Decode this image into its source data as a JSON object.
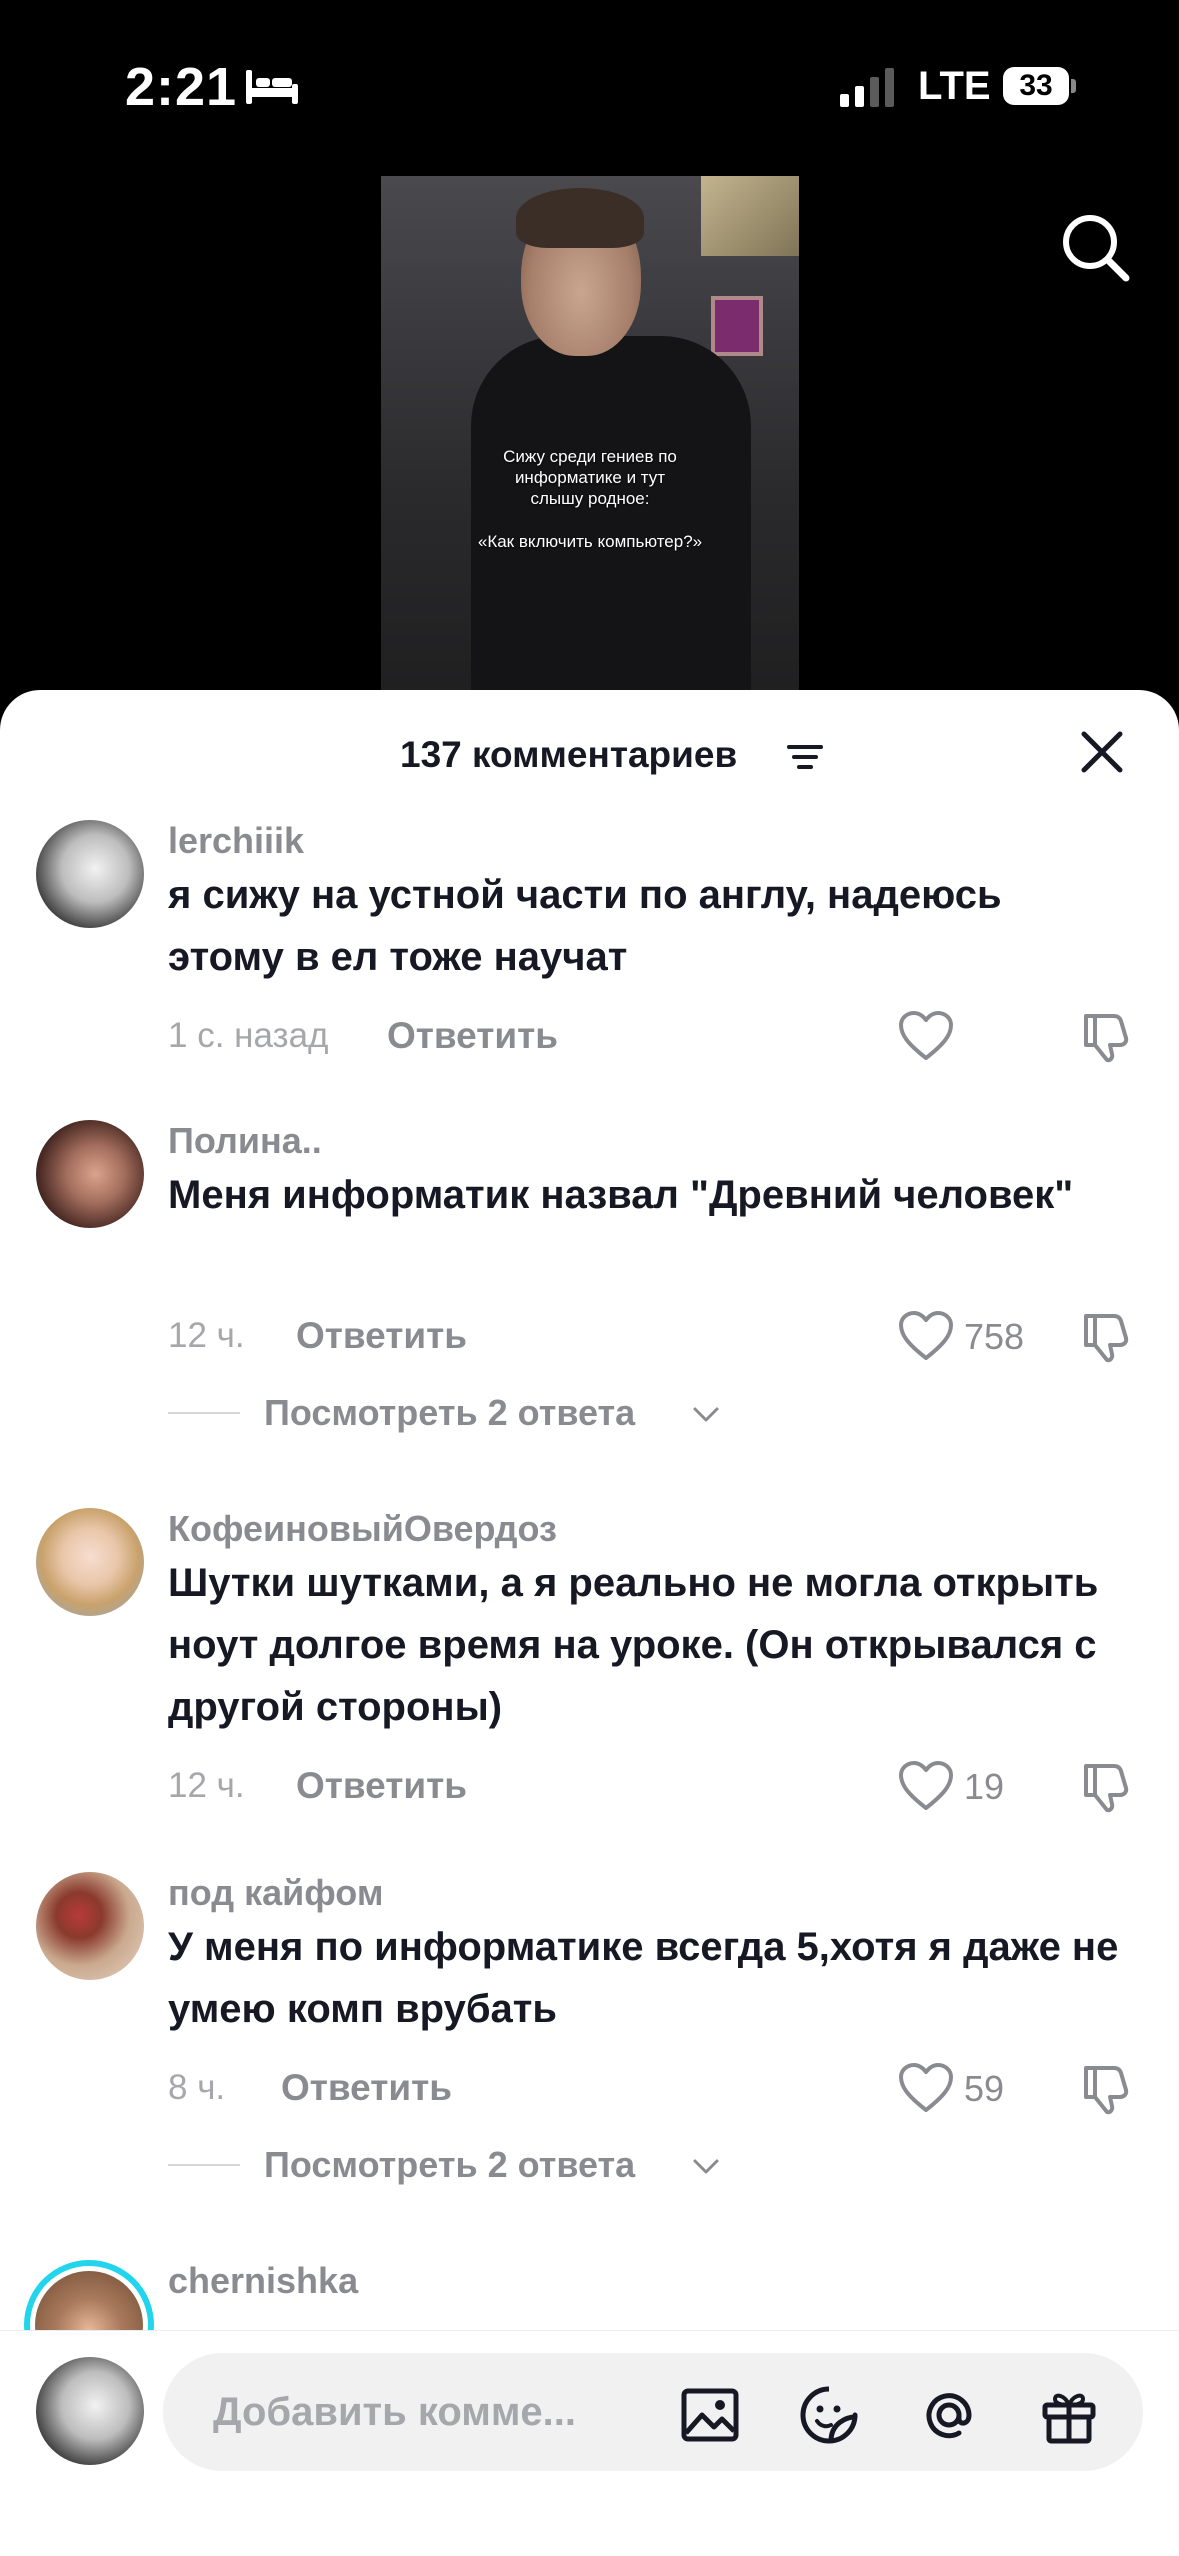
{
  "status_bar": {
    "time": "2:21",
    "network": "LTE",
    "battery": "33"
  },
  "video": {
    "caption_lines": [
      "Сижу среди гениев по",
      "информатике и тут",
      "слышу родное:"
    ],
    "caption_quote": "«Как включить компьютер?»"
  },
  "sheet": {
    "title": "137 комментариев"
  },
  "comments": [
    {
      "user": "lerchiiik",
      "text": "я сижу на устной части по англу, надеюсь этому в ел тоже научат",
      "time": "1 с. назад",
      "reply": "Ответить",
      "likes": ""
    },
    {
      "user": "Полина..",
      "text": "Меня информатик назвал \"Древний человек\"",
      "time": "12 ч.",
      "reply": "Ответить",
      "likes": "758",
      "view_replies": "Посмотреть 2 ответа"
    },
    {
      "user": "КофеиновыйОвердоз",
      "text": "Шутки шутками, а я реально не могла открыть ноут долгое время на уроке. (Он открывался с другой стороны)",
      "time": "12 ч.",
      "reply": "Ответить",
      "likes": "19"
    },
    {
      "user": "под кайфом",
      "text": "У меня по информатике всегда 5,хотя я даже не умею комп врубать",
      "time": "8 ч.",
      "reply": "Ответить",
      "likes": "59",
      "view_replies": "Посмотреть 2 ответа"
    },
    {
      "user": "chernishka"
    }
  ],
  "input": {
    "placeholder": "Добавить комме..."
  },
  "colors": {
    "text": "#161823",
    "muted": "#8a8b91",
    "background": "#ffffff",
    "story_ring": "#20d5ec"
  },
  "icons": [
    "bed-icon",
    "signal-icon",
    "battery-icon",
    "search-icon",
    "sort-icon",
    "close-icon",
    "heart-icon",
    "dislike-icon",
    "chevron-down-icon",
    "image-icon",
    "emoji-icon",
    "mention-icon",
    "gift-icon"
  ]
}
